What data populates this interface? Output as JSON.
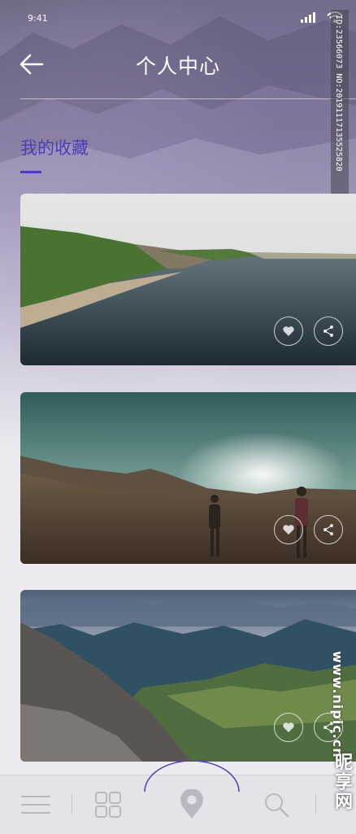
{
  "status_bar": {
    "time": "9:41"
  },
  "header": {
    "title": "个人中心"
  },
  "section": {
    "title": "我的收藏"
  },
  "cards": [
    {
      "scene": "coast-lake"
    },
    {
      "scene": "desert-walkers"
    },
    {
      "scene": "mountain-valley"
    }
  ],
  "watermark": {
    "id_text": "ID:23566073 NO:20191117135525820",
    "brand": "www.nipic.cn",
    "brand_cn": "昵享网"
  },
  "colors": {
    "accent": "#4b3fb8",
    "tab_icon": "#b9b8c0"
  },
  "tabbar": {
    "icons": [
      "menu-icon",
      "grid-icon",
      "location-pin-icon",
      "search-icon",
      "more-icon"
    ]
  }
}
